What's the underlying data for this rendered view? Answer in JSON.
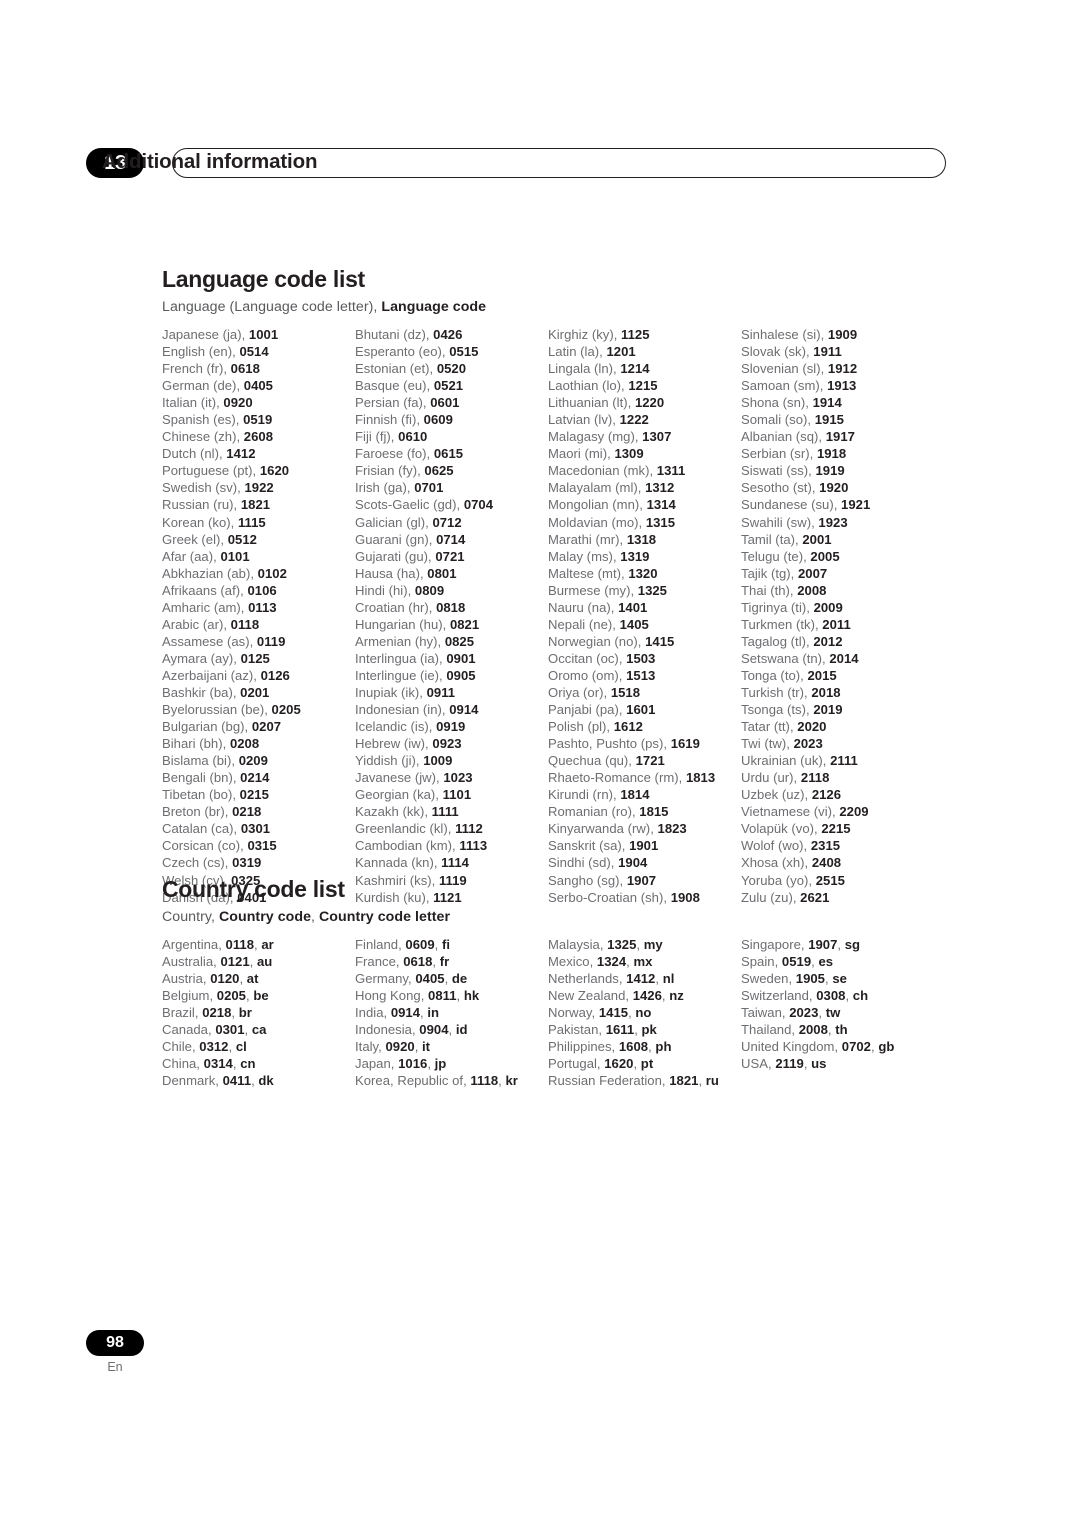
{
  "header": {
    "chapter_number": "13",
    "chapter_title": "Additional information"
  },
  "footer": {
    "page_number": "98",
    "language_marker": "En"
  },
  "language_section": {
    "heading": "Language code list",
    "subheading_plain": "Language (Language code letter), ",
    "subheading_bold": "Language code",
    "columns": [
      [
        {
          "name": "Japanese (ja), ",
          "code": "1001"
        },
        {
          "name": "English (en), ",
          "code": "0514"
        },
        {
          "name": "French (fr), ",
          "code": "0618"
        },
        {
          "name": "German (de), ",
          "code": "0405"
        },
        {
          "name": "Italian (it), ",
          "code": "0920"
        },
        {
          "name": "Spanish (es), ",
          "code": "0519"
        },
        {
          "name": "Chinese (zh), ",
          "code": "2608"
        },
        {
          "name": "Dutch (nl), ",
          "code": "1412"
        },
        {
          "name": "Portuguese (pt), ",
          "code": "1620"
        },
        {
          "name": "Swedish (sv), ",
          "code": "1922"
        },
        {
          "name": "Russian (ru), ",
          "code": "1821"
        },
        {
          "name": "Korean (ko), ",
          "code": "1115"
        },
        {
          "name": "Greek (el), ",
          "code": "0512"
        },
        {
          "name": "Afar (aa), ",
          "code": "0101"
        },
        {
          "name": "Abkhazian (ab), ",
          "code": "0102"
        },
        {
          "name": "Afrikaans (af), ",
          "code": "0106"
        },
        {
          "name": "Amharic (am), ",
          "code": "0113"
        },
        {
          "name": "Arabic (ar), ",
          "code": "0118"
        },
        {
          "name": "Assamese (as), ",
          "code": "0119"
        },
        {
          "name": "Aymara (ay), ",
          "code": "0125"
        },
        {
          "name": "Azerbaijani (az), ",
          "code": "0126"
        },
        {
          "name": "Bashkir (ba), ",
          "code": "0201"
        },
        {
          "name": "Byelorussian (be), ",
          "code": "0205"
        },
        {
          "name": "Bulgarian (bg), ",
          "code": "0207"
        },
        {
          "name": "Bihari (bh), ",
          "code": "0208"
        },
        {
          "name": "Bislama (bi), ",
          "code": "0209"
        },
        {
          "name": "Bengali (bn), ",
          "code": "0214"
        },
        {
          "name": "Tibetan (bo), ",
          "code": "0215"
        },
        {
          "name": "Breton (br), ",
          "code": "0218"
        },
        {
          "name": "Catalan (ca), ",
          "code": "0301"
        },
        {
          "name": "Corsican (co), ",
          "code": "0315"
        },
        {
          "name": "Czech (cs), ",
          "code": "0319"
        },
        {
          "name": "Welsh (cy), ",
          "code": "0325"
        },
        {
          "name": "Danish (da), ",
          "code": "0401"
        }
      ],
      [
        {
          "name": "Bhutani (dz), ",
          "code": "0426"
        },
        {
          "name": "Esperanto (eo), ",
          "code": "0515"
        },
        {
          "name": "Estonian (et), ",
          "code": "0520"
        },
        {
          "name": "Basque (eu), ",
          "code": "0521"
        },
        {
          "name": "Persian (fa), ",
          "code": "0601"
        },
        {
          "name": "Finnish (fi), ",
          "code": "0609"
        },
        {
          "name": "Fiji (fj), ",
          "code": "0610"
        },
        {
          "name": "Faroese (fo), ",
          "code": "0615"
        },
        {
          "name": "Frisian (fy), ",
          "code": "0625"
        },
        {
          "name": "Irish (ga), ",
          "code": "0701"
        },
        {
          "name": "Scots-Gaelic (gd), ",
          "code": "0704"
        },
        {
          "name": "Galician (gl), ",
          "code": "0712"
        },
        {
          "name": "Guarani (gn), ",
          "code": "0714"
        },
        {
          "name": "Gujarati (gu), ",
          "code": "0721"
        },
        {
          "name": "Hausa (ha), ",
          "code": "0801"
        },
        {
          "name": "Hindi (hi), ",
          "code": "0809"
        },
        {
          "name": "Croatian (hr), ",
          "code": "0818"
        },
        {
          "name": "Hungarian (hu), ",
          "code": "0821"
        },
        {
          "name": "Armenian (hy), ",
          "code": "0825"
        },
        {
          "name": "Interlingua (ia), ",
          "code": "0901"
        },
        {
          "name": "Interlingue (ie), ",
          "code": "0905"
        },
        {
          "name": "Inupiak (ik), ",
          "code": "0911"
        },
        {
          "name": "Indonesian (in), ",
          "code": "0914"
        },
        {
          "name": "Icelandic (is), ",
          "code": "0919"
        },
        {
          "name": "Hebrew (iw), ",
          "code": "0923"
        },
        {
          "name": "Yiddish (ji), ",
          "code": "1009"
        },
        {
          "name": "Javanese (jw), ",
          "code": "1023"
        },
        {
          "name": "Georgian (ka), ",
          "code": "1101"
        },
        {
          "name": "Kazakh (kk), ",
          "code": "1111"
        },
        {
          "name": "Greenlandic  (kl), ",
          "code": "1112"
        },
        {
          "name": "Cambodian (km), ",
          "code": "1113"
        },
        {
          "name": "Kannada (kn), ",
          "code": "1114"
        },
        {
          "name": "Kashmiri (ks), ",
          "code": "1119"
        },
        {
          "name": "Kurdish (ku), ",
          "code": "1121"
        }
      ],
      [
        {
          "name": "Kirghiz (ky), ",
          "code": "1125"
        },
        {
          "name": "Latin (la), ",
          "code": "1201"
        },
        {
          "name": "Lingala (ln), ",
          "code": "1214"
        },
        {
          "name": "Laothian (lo), ",
          "code": "1215"
        },
        {
          "name": "Lithuanian (lt), ",
          "code": "1220"
        },
        {
          "name": "Latvian (lv), ",
          "code": "1222"
        },
        {
          "name": "Malagasy (mg), ",
          "code": "1307"
        },
        {
          "name": "Maori (mi), ",
          "code": "1309"
        },
        {
          "name": "Macedonian (mk), ",
          "code": "1311"
        },
        {
          "name": "Malayalam  (ml), ",
          "code": "1312"
        },
        {
          "name": "Mongolian (mn), ",
          "code": "1314"
        },
        {
          "name": "Moldavian (mo), ",
          "code": "1315"
        },
        {
          "name": "Marathi (mr), ",
          "code": "1318"
        },
        {
          "name": "Malay  (ms), ",
          "code": "1319"
        },
        {
          "name": "Maltese (mt), ",
          "code": "1320"
        },
        {
          "name": "Burmese (my), ",
          "code": "1325"
        },
        {
          "name": "Nauru (na), ",
          "code": "1401"
        },
        {
          "name": "Nepali (ne), ",
          "code": "1405"
        },
        {
          "name": "Norwegian (no), ",
          "code": "1415"
        },
        {
          "name": "Occitan (oc), ",
          "code": "1503"
        },
        {
          "name": "Oromo (om), ",
          "code": "1513"
        },
        {
          "name": "Oriya (or), ",
          "code": "1518"
        },
        {
          "name": "Panjabi (pa), ",
          "code": "1601"
        },
        {
          "name": "Polish (pl), ",
          "code": "1612"
        },
        {
          "name": "Pashto, Pushto (ps), ",
          "code": "1619"
        },
        {
          "name": "Quechua (qu), ",
          "code": "1721"
        },
        {
          "name": "Rhaeto-Romance (rm), ",
          "code": "1813"
        },
        {
          "name": "Kirundi (rn), ",
          "code": "1814"
        },
        {
          "name": "Romanian (ro), ",
          "code": "1815"
        },
        {
          "name": "Kinyarwanda (rw), ",
          "code": "1823"
        },
        {
          "name": "Sanskrit (sa), ",
          "code": "1901"
        },
        {
          "name": "Sindhi (sd), ",
          "code": "1904"
        },
        {
          "name": "Sangho (sg), ",
          "code": "1907"
        },
        {
          "name": "Serbo-Croatian (sh), ",
          "code": "1908"
        }
      ],
      [
        {
          "name": "Sinhalese (si), ",
          "code": "1909"
        },
        {
          "name": "Slovak (sk), ",
          "code": "1911"
        },
        {
          "name": "Slovenian (sl), ",
          "code": "1912"
        },
        {
          "name": "Samoan (sm), ",
          "code": "1913"
        },
        {
          "name": "Shona (sn), ",
          "code": "1914"
        },
        {
          "name": "Somali (so), ",
          "code": "1915"
        },
        {
          "name": "Albanian (sq), ",
          "code": "1917"
        },
        {
          "name": "Serbian (sr), ",
          "code": "1918"
        },
        {
          "name": "Siswati (ss), ",
          "code": "1919"
        },
        {
          "name": "Sesotho (st), ",
          "code": "1920"
        },
        {
          "name": "Sundanese (su), ",
          "code": "1921"
        },
        {
          "name": "Swahili (sw), ",
          "code": "1923"
        },
        {
          "name": "Tamil (ta), ",
          "code": "2001"
        },
        {
          "name": "Telugu (te), ",
          "code": "2005"
        },
        {
          "name": "Tajik (tg), ",
          "code": "2007"
        },
        {
          "name": "Thai (th), ",
          "code": "2008"
        },
        {
          "name": "Tigrinya (ti), ",
          "code": "2009"
        },
        {
          "name": "Turkmen (tk), ",
          "code": "2011"
        },
        {
          "name": "Tagalog (tl), ",
          "code": "2012"
        },
        {
          "name": "Setswana (tn), ",
          "code": "2014"
        },
        {
          "name": "Tonga (to), ",
          "code": "2015"
        },
        {
          "name": "Turkish (tr), ",
          "code": "2018"
        },
        {
          "name": "Tsonga (ts), ",
          "code": "2019"
        },
        {
          "name": "Tatar (tt), ",
          "code": "2020"
        },
        {
          "name": "Twi (tw), ",
          "code": "2023"
        },
        {
          "name": "Ukrainian (uk), ",
          "code": "2111"
        },
        {
          "name": "Urdu (ur), ",
          "code": "2118"
        },
        {
          "name": "Uzbek (uz), ",
          "code": "2126"
        },
        {
          "name": "Vietnamese (vi), ",
          "code": "2209"
        },
        {
          "name": "Volapük (vo), ",
          "code": "2215"
        },
        {
          "name": "Wolof (wo), ",
          "code": "2315"
        },
        {
          "name": "Xhosa (xh), ",
          "code": "2408"
        },
        {
          "name": "Yoruba (yo), ",
          "code": "2515"
        },
        {
          "name": "Zulu (zu), ",
          "code": "2621"
        }
      ]
    ]
  },
  "country_section": {
    "heading": "Country code list",
    "subheading_plain": "Country, ",
    "subheading_bold_1": "Country code",
    "subheading_mid": ", ",
    "subheading_bold_2": "Country code letter",
    "columns": [
      [
        {
          "name": "Argentina, ",
          "code": "0118",
          "sep": ", ",
          "letter": "ar"
        },
        {
          "name": "Australia, ",
          "code": "0121",
          "sep": ", ",
          "letter": "au"
        },
        {
          "name": "Austria, ",
          "code": "0120",
          "sep": ", ",
          "letter": "at"
        },
        {
          "name": "Belgium, ",
          "code": "0205",
          "sep": ", ",
          "letter": "be"
        },
        {
          "name": "Brazil, ",
          "code": "0218",
          "sep": ", ",
          "letter": "br"
        },
        {
          "name": "Canada, ",
          "code": "0301",
          "sep": ", ",
          "letter": "ca"
        },
        {
          "name": "Chile, ",
          "code": "0312",
          "sep": ", ",
          "letter": "cl"
        },
        {
          "name": "China, ",
          "code": "0314",
          "sep": ", ",
          "letter": "cn"
        },
        {
          "name": "Denmark, ",
          "code": "0411",
          "sep": ", ",
          "letter": "dk"
        }
      ],
      [
        {
          "name": "Finland, ",
          "code": "0609",
          "sep": ", ",
          "letter": "fi"
        },
        {
          "name": "France, ",
          "code": "0618",
          "sep": ", ",
          "letter": "fr"
        },
        {
          "name": "Germany, ",
          "code": "0405",
          "sep": ", ",
          "letter": "de"
        },
        {
          "name": "Hong Kong, ",
          "code": "0811",
          "sep": ", ",
          "letter": "hk"
        },
        {
          "name": "India, ",
          "code": "0914",
          "sep": ", ",
          "letter": "in"
        },
        {
          "name": "Indonesia, ",
          "code": "0904",
          "sep": ", ",
          "letter": "id"
        },
        {
          "name": "Italy, ",
          "code": "0920",
          "sep": ", ",
          "letter": "it"
        },
        {
          "name": "Japan, ",
          "code": "1016",
          "sep": ", ",
          "letter": "jp"
        },
        {
          "name": "Korea, Republic of, ",
          "code": "1118",
          "sep": ", ",
          "letter": "kr"
        }
      ],
      [
        {
          "name": "Malaysia, ",
          "code": "1325",
          "sep": ", ",
          "letter": "my"
        },
        {
          "name": "Mexico, ",
          "code": "1324",
          "sep": ", ",
          "letter": "mx"
        },
        {
          "name": "Netherlands, ",
          "code": "1412",
          "sep": ", ",
          "letter": "nl"
        },
        {
          "name": "New Zealand, ",
          "code": "1426",
          "sep": ", ",
          "letter": "nz"
        },
        {
          "name": "Norway, ",
          "code": "1415",
          "sep": ", ",
          "letter": "no"
        },
        {
          "name": "Pakistan, ",
          "code": "1611",
          "sep": ", ",
          "letter": "pk"
        },
        {
          "name": "Philippines, ",
          "code": "1608",
          "sep": ", ",
          "letter": "ph"
        },
        {
          "name": "Portugal, ",
          "code": "1620",
          "sep": ", ",
          "letter": "pt"
        },
        {
          "name": "Russian Federation, ",
          "code": "1821",
          "sep": ", ",
          "letter": "ru"
        }
      ],
      [
        {
          "name": "Singapore, ",
          "code": "1907",
          "sep": ", ",
          "letter": "sg"
        },
        {
          "name": "Spain, ",
          "code": "0519",
          "sep": ", ",
          "letter": "es"
        },
        {
          "name": "Sweden, ",
          "code": "1905",
          "sep": ", ",
          "letter": "se"
        },
        {
          "name": "Switzerland, ",
          "code": "0308",
          "sep": ", ",
          "letter": "ch"
        },
        {
          "name": "Taiwan, ",
          "code": "2023",
          "sep": ", ",
          "letter": "tw"
        },
        {
          "name": "Thailand, ",
          "code": "2008",
          "sep": ", ",
          "letter": "th"
        },
        {
          "name": "United Kingdom, ",
          "code": "0702",
          "sep": ", ",
          "letter": "gb"
        },
        {
          "name": "USA, ",
          "code": "2119",
          "sep": ", ",
          "letter": "us"
        }
      ]
    ]
  },
  "colors": {
    "ink": "#231f20",
    "muted": "#6d6e71",
    "badge_bg": "#000000"
  }
}
